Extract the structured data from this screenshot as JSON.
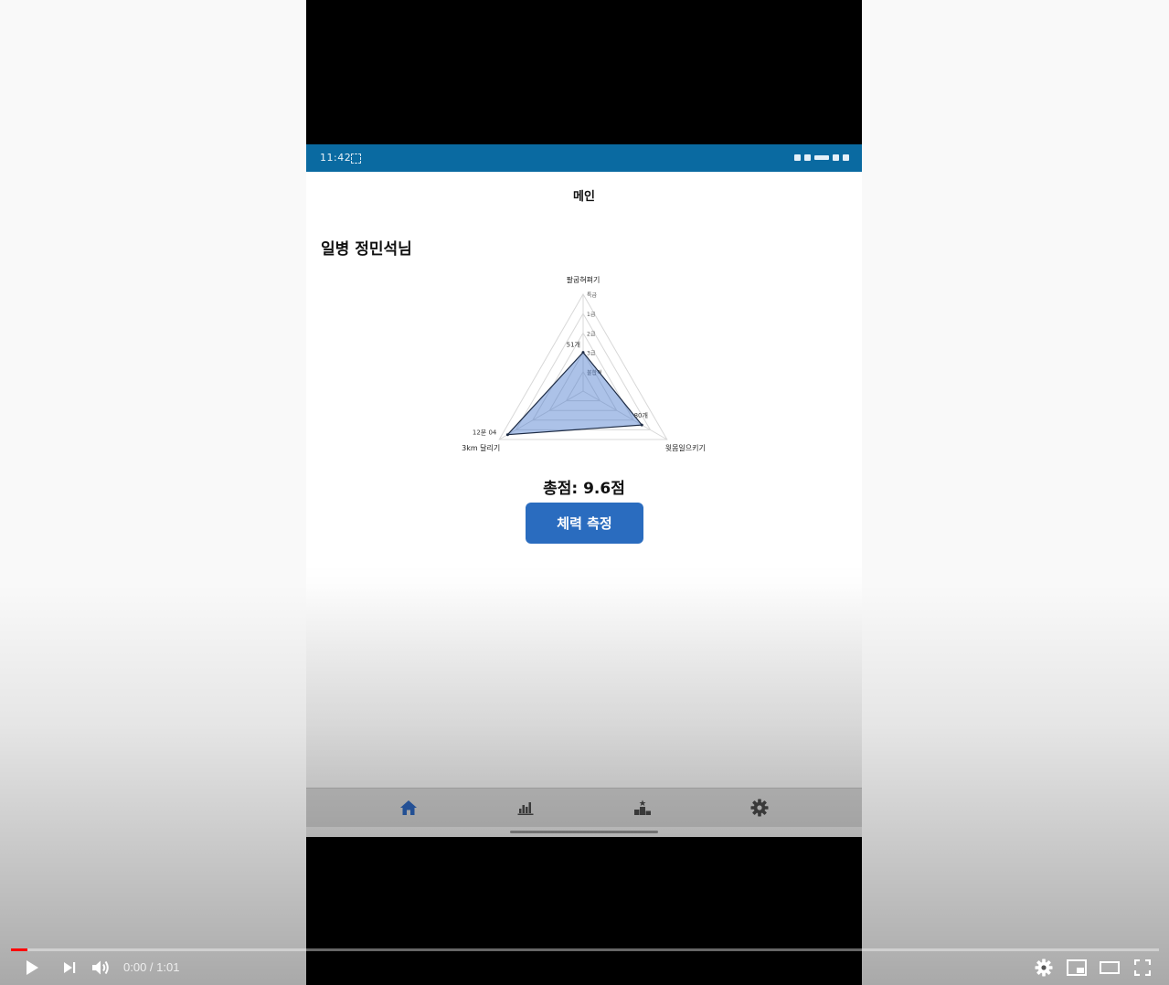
{
  "status_bar": {
    "time": "11:42"
  },
  "app": {
    "title": "메인",
    "user_name": "일병 정민석님",
    "total_score": "총점: 9.6점",
    "measure_button": "체력 측정",
    "accent_color": "#2a6cbf"
  },
  "chart_data": {
    "type": "radar",
    "axes": [
      "팔굽혀펴기",
      "윗몸일으키기",
      "3km 달리기"
    ],
    "grades": [
      "특급",
      "1급",
      "2급",
      "3급",
      "불합격"
    ],
    "series": [
      {
        "axis_labels": [
          "51개",
          "80개",
          "12분 04"
        ],
        "levels": [
          0.4,
          0.7,
          0.9
        ]
      }
    ]
  },
  "bottom_nav": [
    {
      "icon": "home-icon",
      "active": true
    },
    {
      "icon": "bar-chart-icon",
      "active": false
    },
    {
      "icon": "ranking-icon",
      "active": false
    },
    {
      "icon": "gear-icon",
      "active": false
    }
  ],
  "player": {
    "current_time": "0:00",
    "duration": "1:01",
    "time_text": "0:00 / 1:01",
    "progress_fraction": 0.014
  }
}
